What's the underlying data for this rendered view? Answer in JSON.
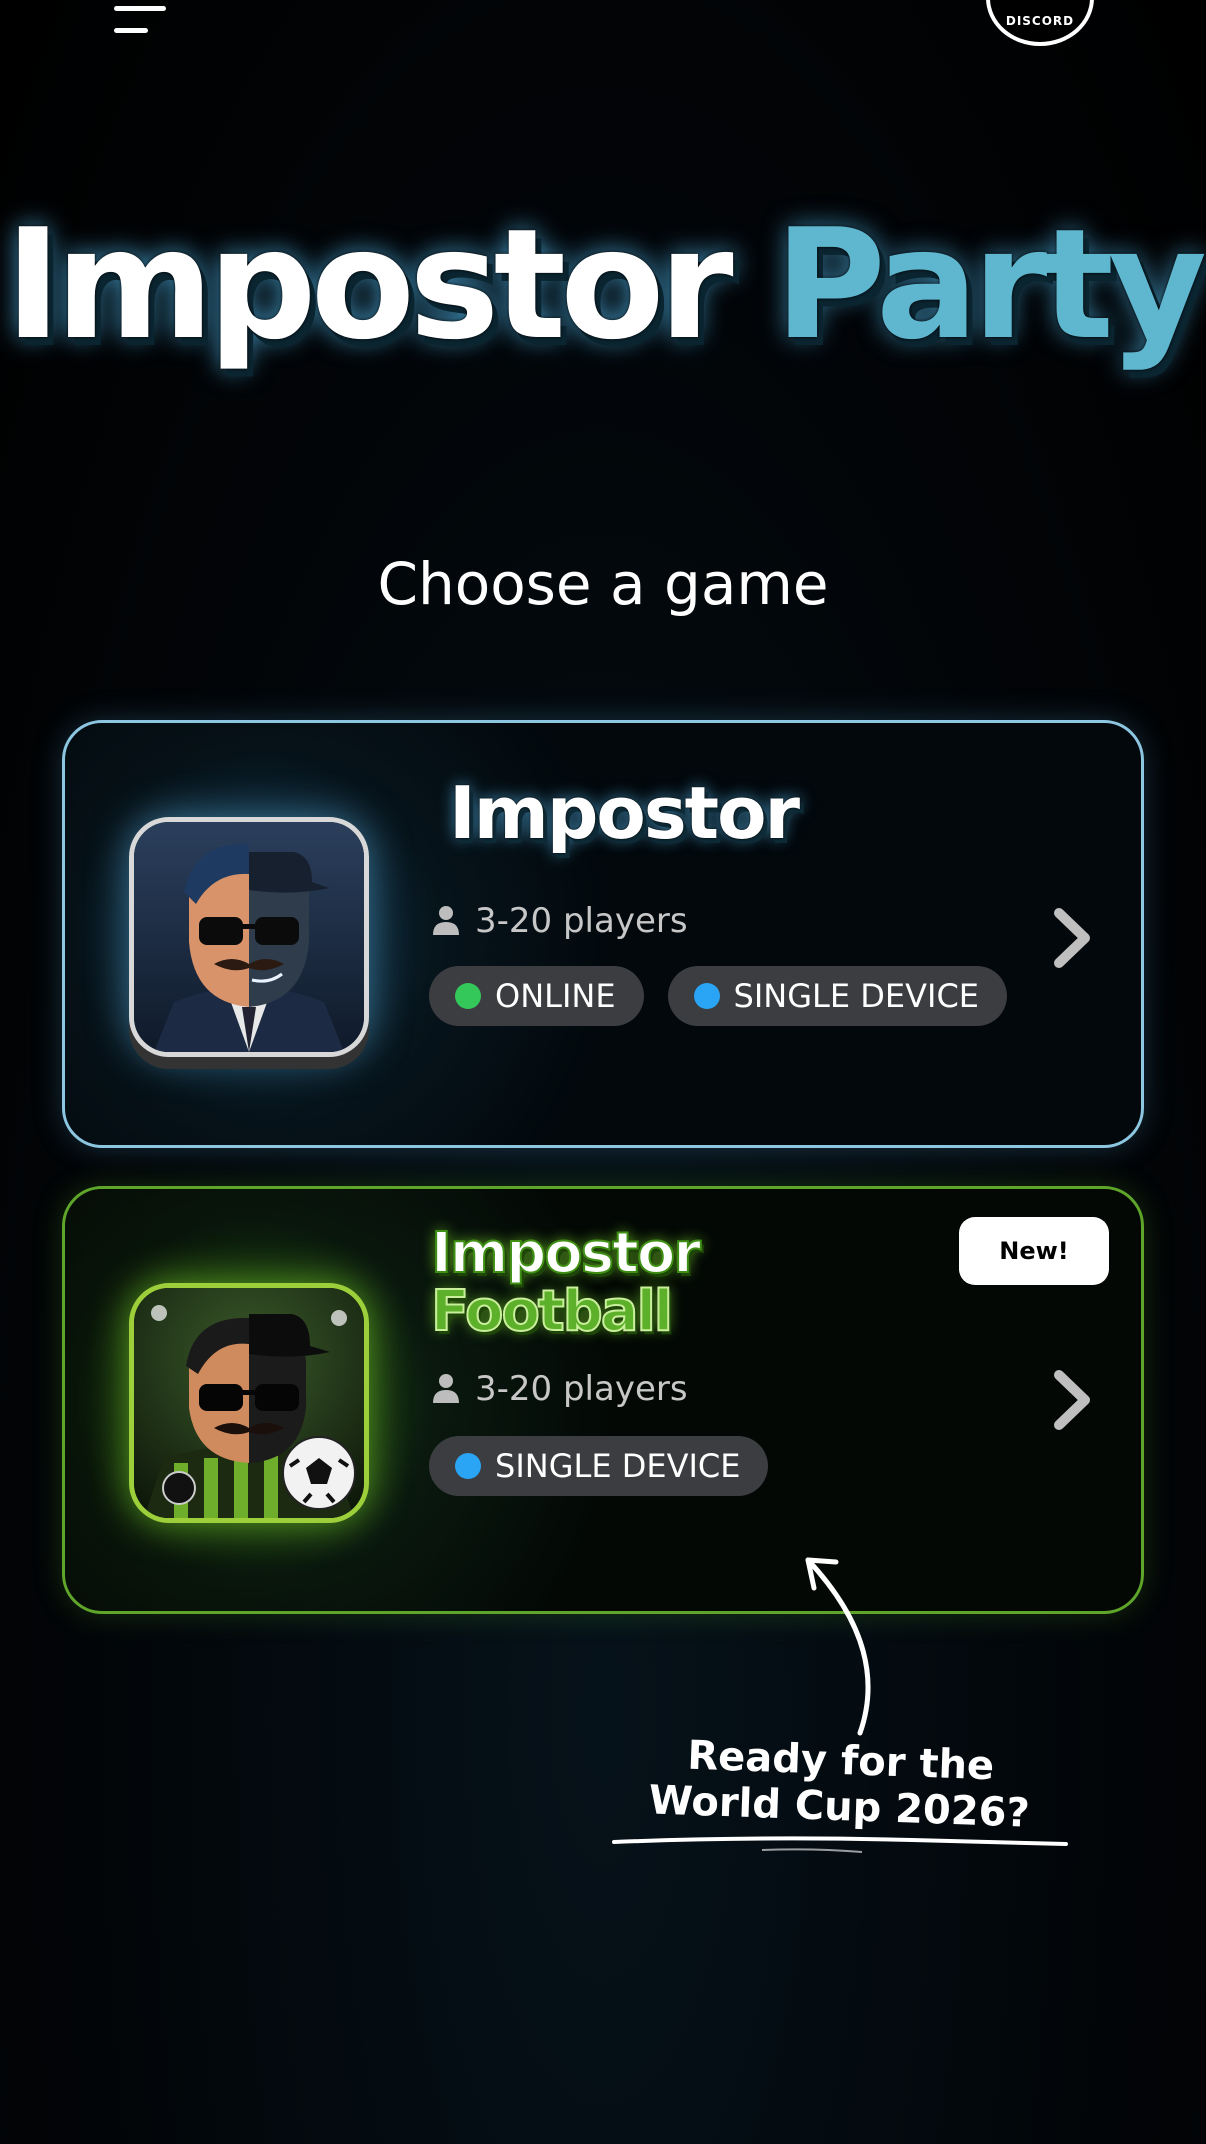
{
  "header": {
    "menu_icon": "hamburger-menu-icon",
    "discord_label": "DISCORD"
  },
  "hero": {
    "title_part1": "Impostor",
    "title_part2": "Party"
  },
  "section": {
    "heading": "Choose a game"
  },
  "games": [
    {
      "title": "Impostor",
      "players": "3-20 players",
      "badges": [
        {
          "label": "ONLINE",
          "color": "#34c759"
        },
        {
          "label": "SINGLE DEVICE",
          "color": "#2aa4f4"
        }
      ],
      "accent": "#8cc6e0",
      "icon": "impostor-game-icon"
    },
    {
      "title_line1": "Impostor",
      "title_line2": "Football",
      "players": "3-20 players",
      "badges": [
        {
          "label": "SINGLE DEVICE",
          "color": "#2aa4f4"
        }
      ],
      "new_label": "New!",
      "accent": "#5fa52a",
      "icon": "impostor-football-game-icon"
    }
  ],
  "promo": {
    "line1": "Ready for the",
    "line2": "World Cup 2026?"
  },
  "colors": {
    "brand_blue": "#5fb6cf",
    "brand_green": "#5db12a",
    "badge_bg": "#3b3d40"
  }
}
